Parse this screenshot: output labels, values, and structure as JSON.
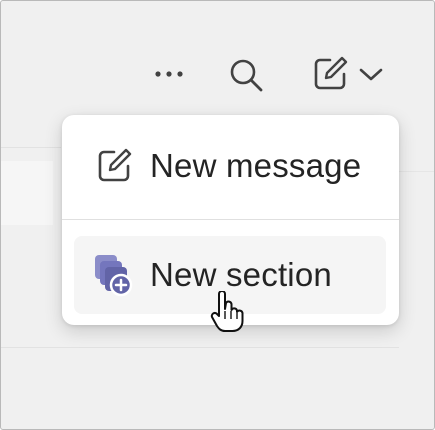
{
  "toolbar": {
    "more_icon": "more-horizontal-icon",
    "search_icon": "search-icon",
    "compose_icon": "compose-icon",
    "chevron_icon": "chevron-down-icon"
  },
  "menu": {
    "items": [
      {
        "label": "New message",
        "icon": "compose-icon"
      },
      {
        "label": "New section",
        "icon": "new-section-icon"
      }
    ]
  },
  "colors": {
    "accent": "#6264a7",
    "icon": "#424242",
    "text": "#242424",
    "hover_bg": "#f5f5f5"
  },
  "cursor": "hand-pointer-cursor"
}
